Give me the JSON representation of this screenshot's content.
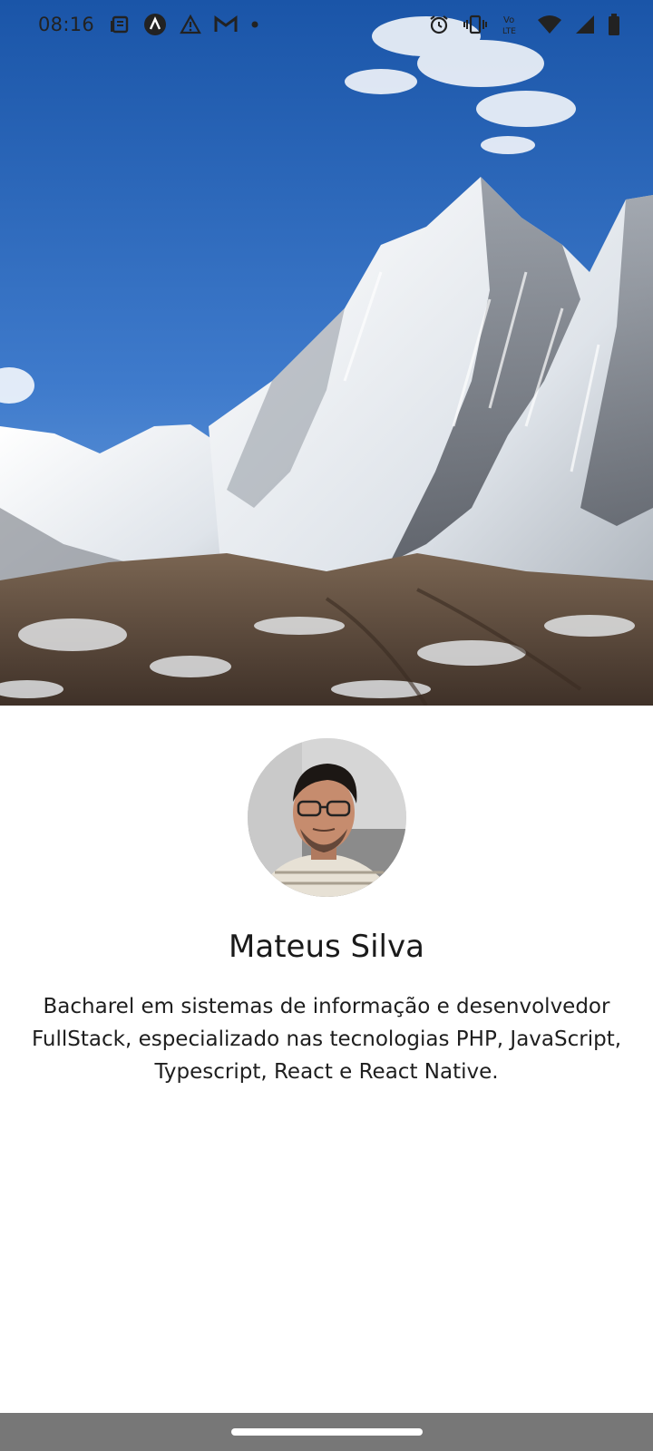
{
  "status_bar": {
    "time": "08:16",
    "notification_icons": [
      "news-icon",
      "app-a-icon",
      "warning-icon",
      "gmail-icon",
      "dot-icon"
    ],
    "system_icons": [
      "alarm-icon",
      "vibrate-icon",
      "volte-icon",
      "wifi-icon",
      "signal-icon",
      "battery-icon"
    ],
    "volte_label_top": "Vo",
    "volte_label_bottom": "LTE"
  },
  "cover": {
    "image": "mountain-landscape"
  },
  "profile": {
    "avatar": "profile-photo",
    "name": "Mateus Silva",
    "bio": "Bacharel em sistemas de informação e desenvolvedor FullStack, especializado nas tecnologias PHP, JavaScript, Typescript, React e React Native."
  },
  "colors": {
    "sky_top": "#1f5bb0",
    "sky_bottom": "#5f95d8",
    "snow": "#eef1f5",
    "rock": "#6f6a66",
    "ground": "#5b4838",
    "nav_bar": "#777777"
  }
}
